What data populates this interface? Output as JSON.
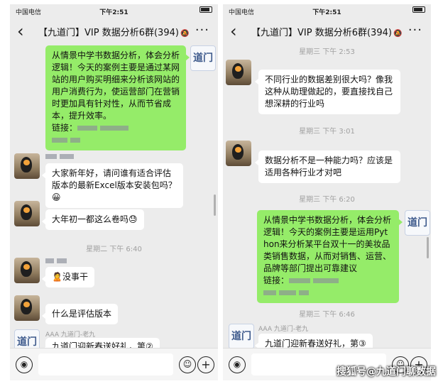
{
  "left": {
    "status": {
      "carrier": "中国电信",
      "time": "下午2:51"
    },
    "nav": {
      "back": "‹",
      "title": "【九道门】VIP 数据分析6群(394)",
      "mute": "🔕",
      "more": "···"
    },
    "messages": {
      "m1": "从情景中学书数据分析，体会分析逻辑！今天的案例主要是通过某网站的用户购买明细来分析该网站的用户消费行为，使运营部门在营销时更加具有针对性，从而节省成本，提升效率。",
      "m1_link": "链接：",
      "m2": "大家新年好，请问谁有适合评估版本的最新Excel版本安装包吗？😀",
      "m3": "大年初一都这么卷吗😓",
      "ts1": "星期二 下午 6:40",
      "m4": "🙎没事干",
      "m5": "什么是评估版本",
      "sender6": "AAA 九道门-老九",
      "m6": "九道门迎新春送好礼，第②"
    }
  },
  "right": {
    "status": {
      "carrier": "中国电信",
      "time": "下午2:51"
    },
    "nav": {
      "back": "‹",
      "title": "【九道门】VIP 数据分析6群(394)",
      "mute": "🔕",
      "more": "···"
    },
    "messages": {
      "ts1": "星期三 下午 2:53",
      "m1": "不同行业的数据差别很大吗？像我这种从助理做起的，要直接找自己想深耕的行业吗",
      "ts2": "星期三 下午 3:01",
      "m2": "数据分析不是一种能力吗？应该是适用各种行业才对吧",
      "ts3": "星期三 下午 6:20",
      "m3": "从情景中学书数据分析，体会分析逻辑！今天的案例主要是运用Python来分析某平台双十一的美妆品类销售数据，从而对销售、运营、品牌等部门提出可靠建议",
      "m3_link": "链接：",
      "ts4": "星期三 下午 6:46",
      "sender5": "AAA 九道门-老九",
      "m5": "九道门迎新春送好礼，第③"
    }
  },
  "icons": {
    "logo_text": "道门",
    "voice": "◉",
    "emoji": "☺",
    "plus": "+"
  },
  "watermark": "搜狐号@九道门聊数据"
}
